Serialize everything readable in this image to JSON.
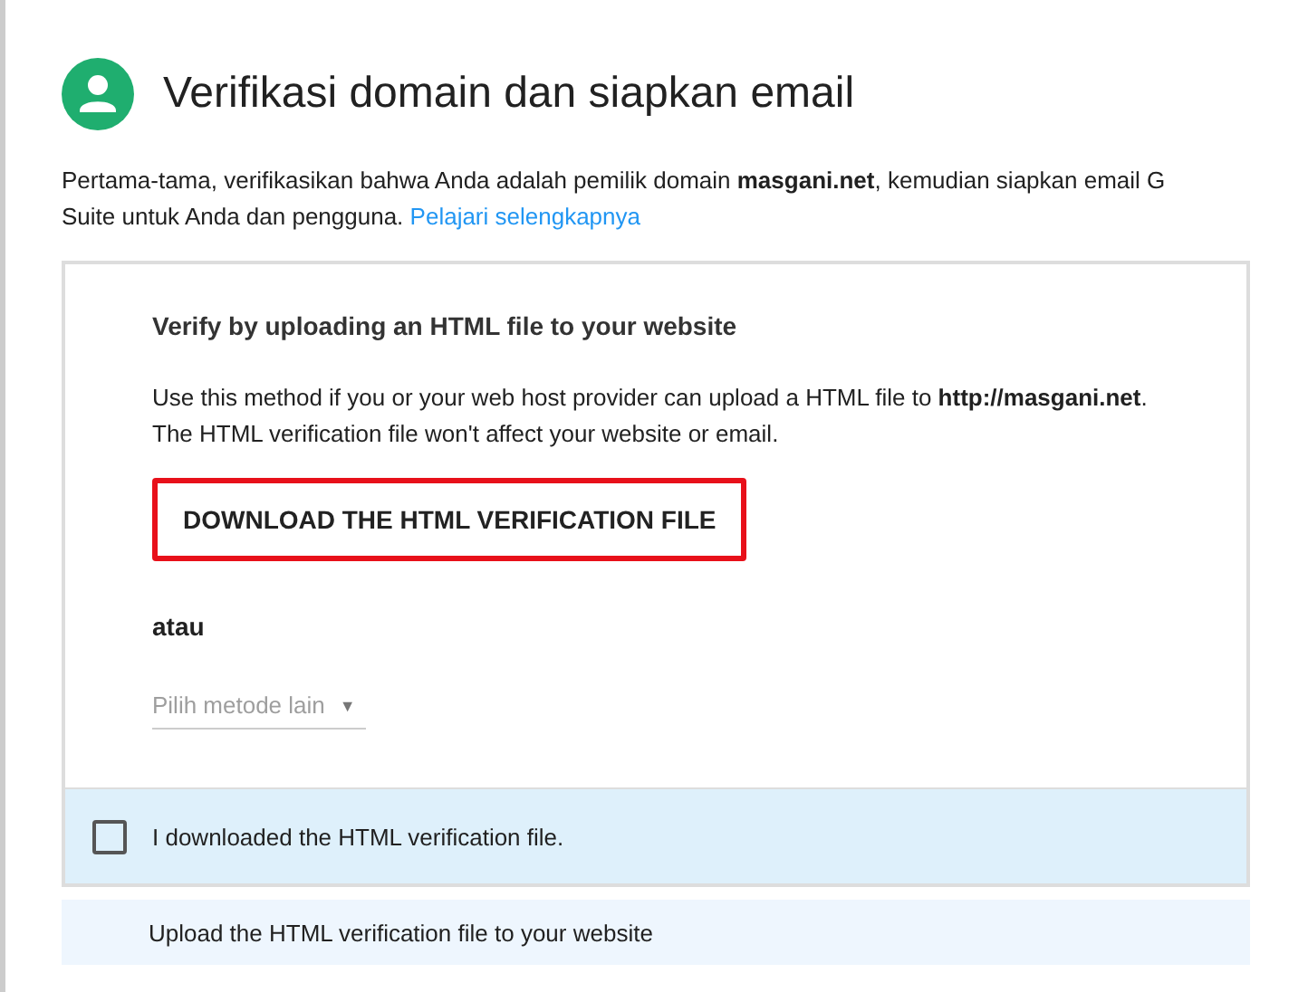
{
  "header": {
    "title": "Verifikasi domain dan siapkan email"
  },
  "intro": {
    "text": "Pertama-tama, verifikasikan bahwa Anda adalah pemilik domain **masgani.net**, kemudian siapkan email G Suite untuk Anda dan pengguna.",
    "link": "Pelajari selengkapnya"
  },
  "method": {
    "heading": "Verify by uploading an HTML file to your website",
    "description": "Use this method if you or your web host provider can upload a HTML file to **http://masgani.net**. The HTML verification file won't affect your website or email.",
    "download_button": "DOWNLOAD THE HTML VERIFICATION FILE",
    "download_highlighted": true,
    "or_label": "atau",
    "method_dropdown": {
      "placeholder": "Pilih metode lain",
      "arrow": "▼"
    }
  },
  "confirm": {
    "label": "I downloaded the HTML verification file.",
    "checked": false
  },
  "next_step": {
    "label": "Upload the HTML verification file to your website"
  }
}
